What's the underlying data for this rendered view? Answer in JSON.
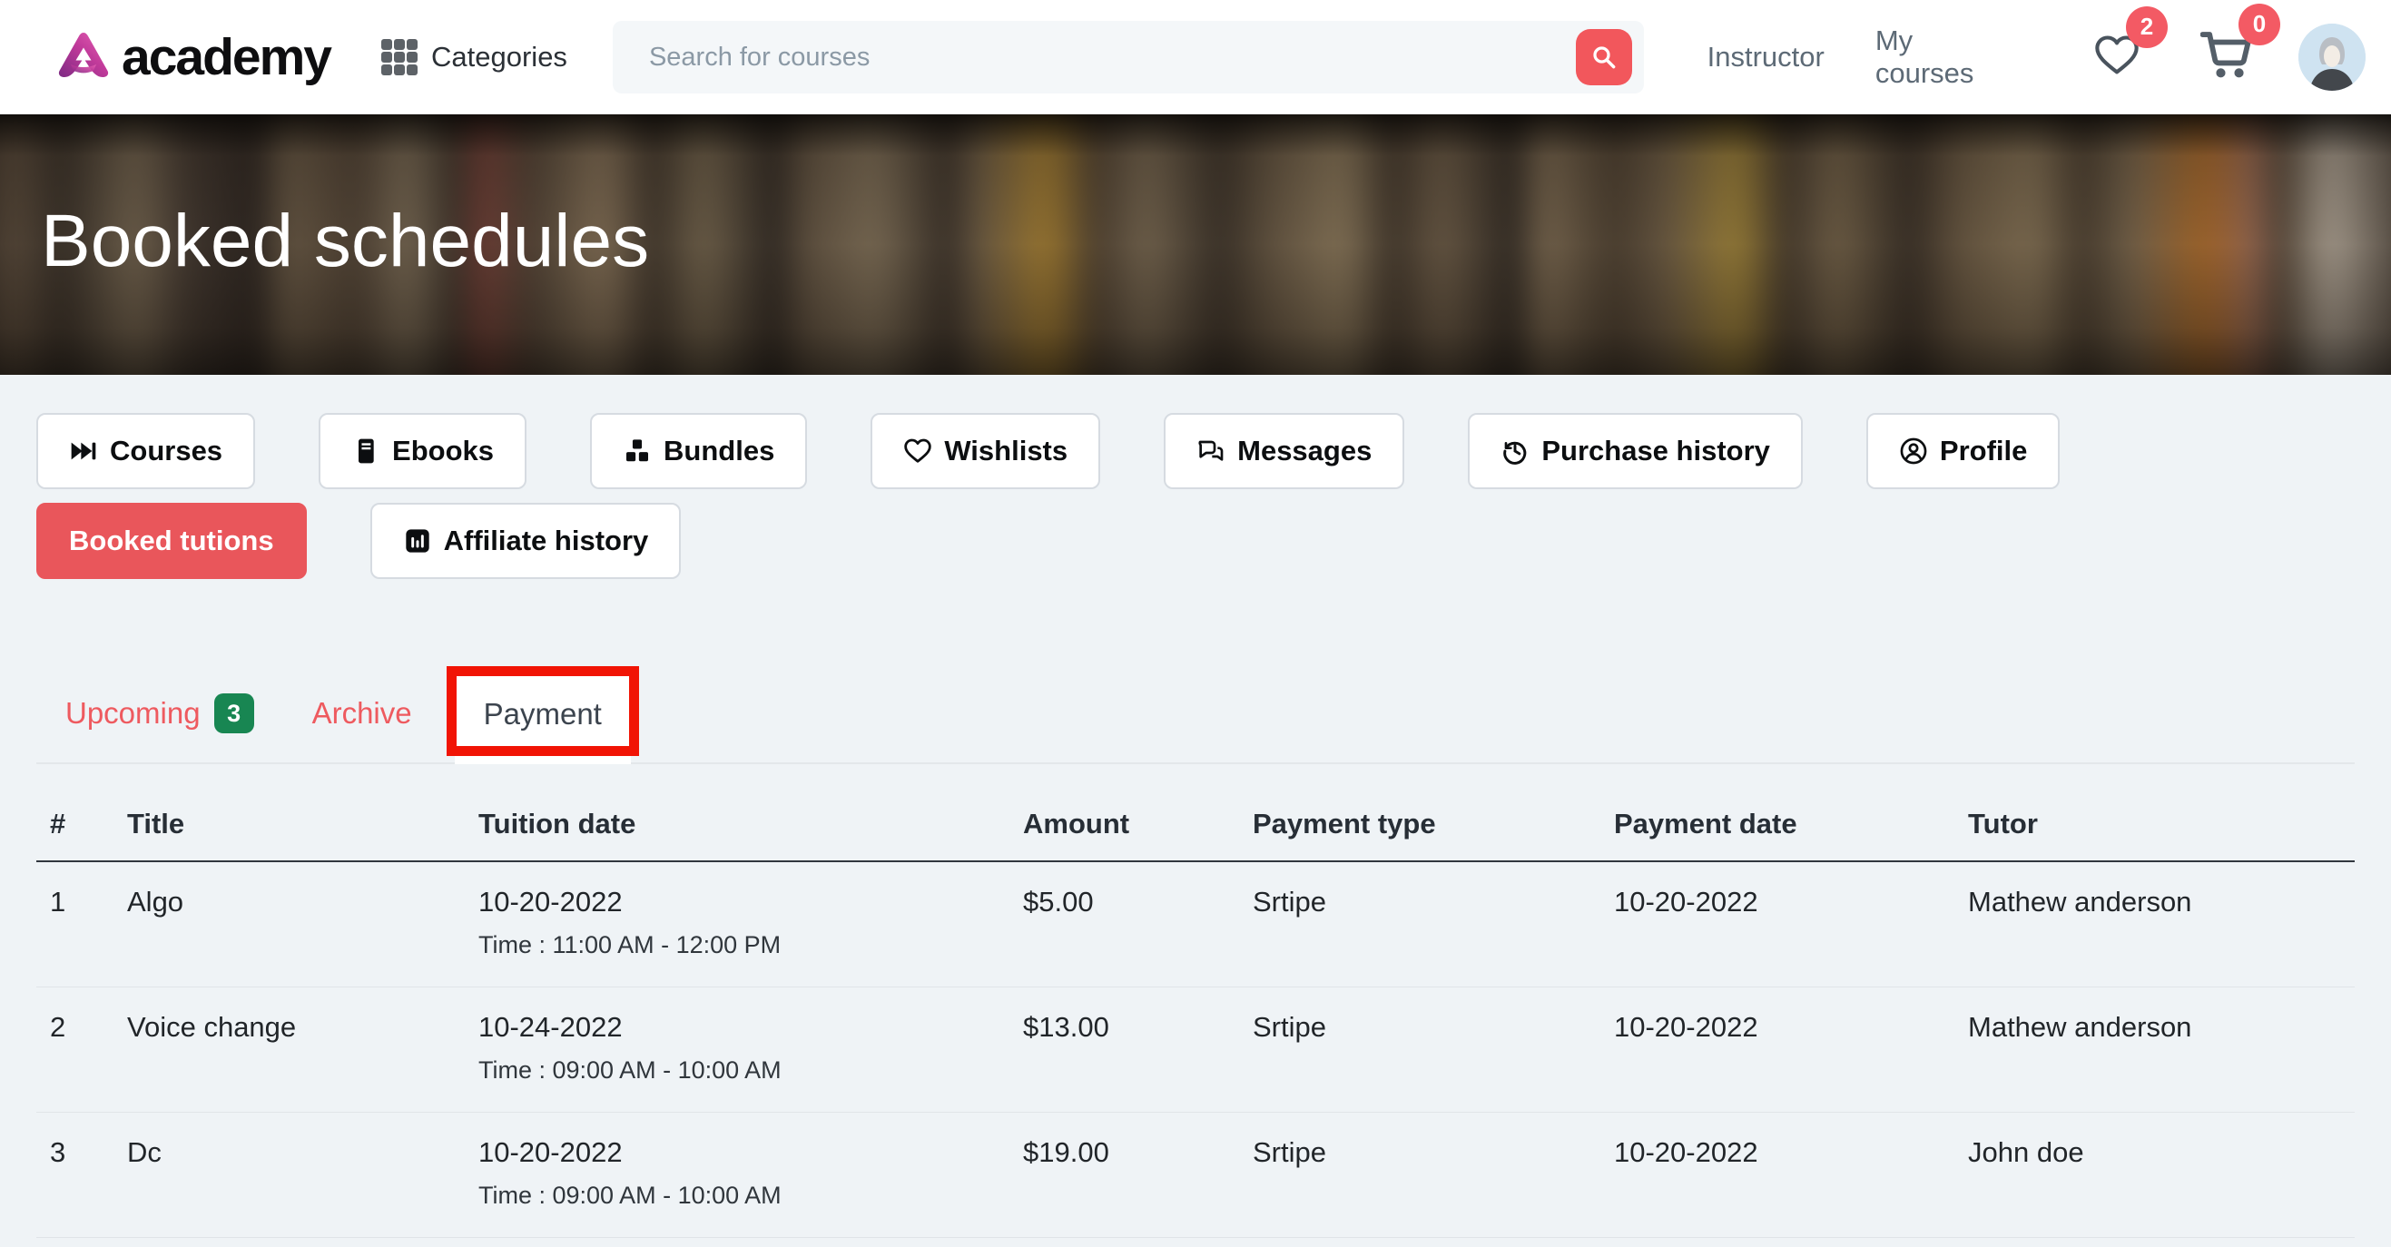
{
  "navbar": {
    "brand": "academy",
    "categories_label": "Categories",
    "search_placeholder": "Search for courses",
    "links": {
      "instructor": "Instructor",
      "my_courses": "My courses"
    },
    "wishlist_count": "2",
    "cart_count": "0",
    "icons": [
      "grid-icon",
      "search-icon",
      "heart-icon",
      "cart-icon",
      "avatar"
    ]
  },
  "hero": {
    "title": "Booked schedules"
  },
  "menu": {
    "buttons": [
      {
        "label": "Courses",
        "icon": "skip-forward-icon"
      },
      {
        "label": "Ebooks",
        "icon": "book-icon"
      },
      {
        "label": "Bundles",
        "icon": "boxes-icon"
      },
      {
        "label": "Wishlists",
        "icon": "heart-outline-icon"
      },
      {
        "label": "Messages",
        "icon": "chat-icon"
      },
      {
        "label": "Purchase history",
        "icon": "history-icon"
      },
      {
        "label": "Profile",
        "icon": "person-circle-icon"
      }
    ],
    "active_button": {
      "label": "Booked tutions"
    },
    "affiliate_button": {
      "label": "Affiliate history",
      "icon": "bar-chart-icon"
    }
  },
  "tabs": [
    {
      "label": "Upcoming",
      "badge": "3",
      "active": false
    },
    {
      "label": "Archive",
      "active": false
    },
    {
      "label": "Payment",
      "active": true,
      "highlighted_by_red_annotation": true
    }
  ],
  "table": {
    "headers": [
      "#",
      "Title",
      "Tuition date",
      "Amount",
      "Payment type",
      "Payment date",
      "Tutor"
    ],
    "rows": [
      {
        "num": "1",
        "title": "Algo",
        "tuition_date": "10-20-2022",
        "time": "Time : 11:00 AM - 12:00 PM",
        "amount": "$5.00",
        "payment_type": "Srtipe",
        "payment_date": "10-20-2022",
        "tutor": "Mathew anderson"
      },
      {
        "num": "2",
        "title": "Voice change",
        "tuition_date": "10-24-2022",
        "time": "Time : 09:00 AM - 10:00 AM",
        "amount": "$13.00",
        "payment_type": "Srtipe",
        "payment_date": "10-20-2022",
        "tutor": "Mathew anderson"
      },
      {
        "num": "3",
        "title": "Dc",
        "tuition_date": "10-20-2022",
        "time": "Time : 09:00 AM - 10:00 AM",
        "amount": "$19.00",
        "payment_type": "Srtipe",
        "payment_date": "10-20-2022",
        "tutor": "John doe"
      }
    ]
  },
  "colors": {
    "accent_red": "#e9565b",
    "annotation_red": "#f11405",
    "badge_green": "#188652",
    "badge_red": "#f35a64",
    "page_bg": "#eff3f6",
    "brand_gradient": [
      "#7d2a83",
      "#e863b5"
    ]
  }
}
